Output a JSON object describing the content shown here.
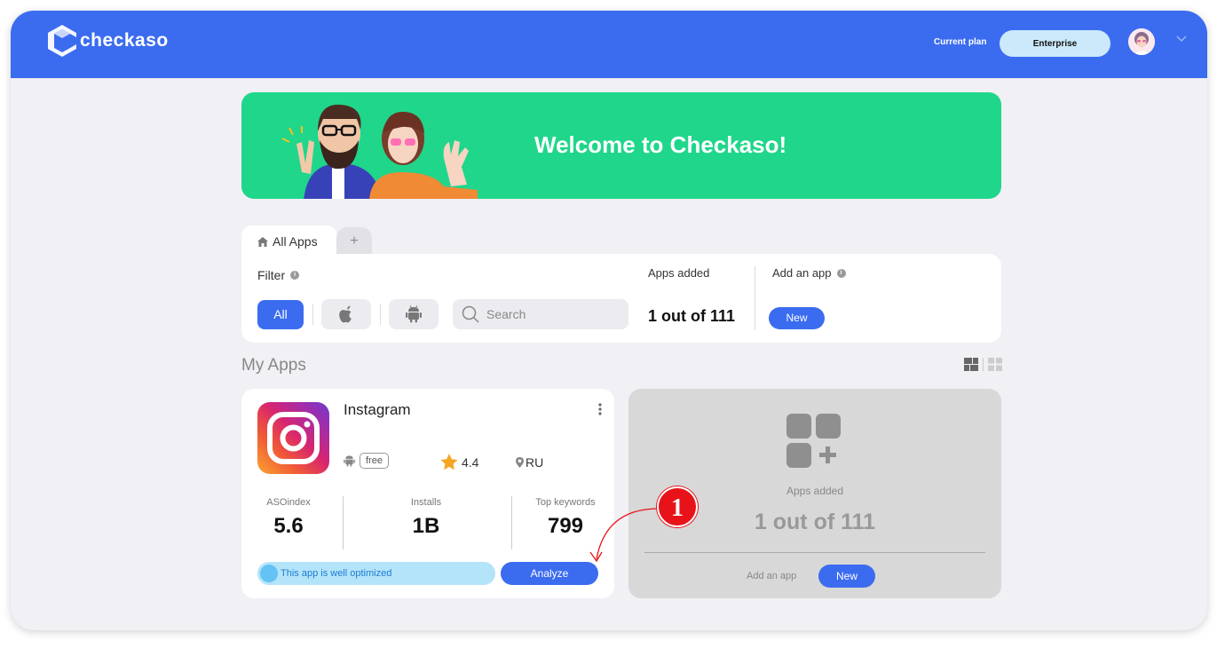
{
  "header": {
    "logo_text": "checkaso",
    "current_plan_label": "Current plan",
    "plan_button": "Enterprise",
    "colors": {
      "topbar": "#3b6cf0",
      "plan_button": "#cbe9fb"
    }
  },
  "banner": {
    "title": "Welcome to Checkaso!",
    "color": "#1fd68b"
  },
  "tabs": {
    "active_label": "All Apps",
    "add_label": "+"
  },
  "filter": {
    "label": "Filter",
    "info_icon": "i",
    "all_label": "All",
    "search_placeholder": "Search",
    "apps_added_label": "Apps added",
    "apps_added_value": "1 out of 111",
    "add_app_label": "Add an app",
    "new_button": "New"
  },
  "my_apps": {
    "title": "My Apps",
    "app": {
      "name": "Instagram",
      "pricing": "free",
      "rating": "4.4",
      "region": "RU",
      "stats": [
        {
          "label": "ASOindex",
          "value": "5.6"
        },
        {
          "label": "Installs",
          "value": "1B"
        },
        {
          "label": "Top keywords",
          "value": "799"
        }
      ],
      "optimization_status": "This app is well optimized",
      "analyze_button": "Analyze"
    },
    "add_card": {
      "apps_added_label": "Apps added",
      "apps_added_value": "1 out of 111",
      "add_app_label": "Add an app",
      "new_button": "New"
    }
  },
  "annotation": {
    "callout_number": "1",
    "color": "#e8131a"
  }
}
